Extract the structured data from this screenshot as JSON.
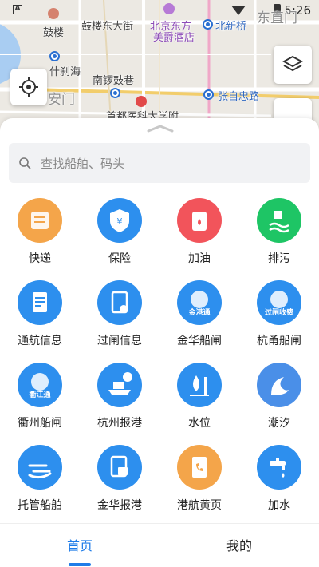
{
  "status_bar": {
    "time": "5:26",
    "notif_badge": "A"
  },
  "map": {
    "labels": {
      "gulou": "鼓楼",
      "gulou_east": "鼓楼东大街",
      "beijing_dongfang": "北京东方",
      "meijue": "美爵酒店",
      "beixinqiao": "北新桥",
      "dongzhimen": "东直门",
      "shichahai": "什刹海",
      "nanluoguxiang": "南锣鼓巷",
      "anmen": "安门",
      "zhangzizhong": "张自忠路",
      "hospital": "首都医科大学附"
    }
  },
  "search": {
    "placeholder": "查找船舶、码头"
  },
  "services": [
    {
      "label": "快递",
      "icon": "express-icon",
      "color": "#f4a54a"
    },
    {
      "label": "保险",
      "icon": "insurance-icon",
      "color": "#2d8fee"
    },
    {
      "label": "加油",
      "icon": "fuel-icon",
      "color": "#f2545b"
    },
    {
      "label": "排污",
      "icon": "sewage-icon",
      "color": "#1ec565"
    },
    {
      "label": "通航信息",
      "icon": "navigation-info-icon",
      "color": "#2d8fee"
    },
    {
      "label": "过闸信息",
      "icon": "lock-info-icon",
      "color": "#2d8fee"
    },
    {
      "label": "金华船闸",
      "icon": "jinhua-lock-icon",
      "color": "#2d8fee",
      "badge": "金港通"
    },
    {
      "label": "杭甬船闸",
      "icon": "hangyong-lock-icon",
      "color": "#2d8fee",
      "badge": "过闸收费"
    },
    {
      "label": "衢州船闸",
      "icon": "quzhou-lock-icon",
      "color": "#2d8fee",
      "badge": "衢江通"
    },
    {
      "label": "杭州报港",
      "icon": "hangzhou-port-icon",
      "color": "#2d8fee"
    },
    {
      "label": "水位",
      "icon": "water-level-icon",
      "color": "#2d8fee"
    },
    {
      "label": "潮汐",
      "icon": "tide-icon",
      "color": "#4a8fe8"
    },
    {
      "label": "托管船舶",
      "icon": "managed-ship-icon",
      "color": "#2d8fee"
    },
    {
      "label": "金华报港",
      "icon": "jinhua-port-icon",
      "color": "#2d8fee"
    },
    {
      "label": "港航黄页",
      "icon": "yellow-pages-icon",
      "color": "#f4a54a"
    },
    {
      "label": "加水",
      "icon": "water-supply-icon",
      "color": "#2d8fee"
    }
  ],
  "tabs": [
    {
      "label": "首页",
      "active": true
    },
    {
      "label": "我的",
      "active": false
    }
  ]
}
